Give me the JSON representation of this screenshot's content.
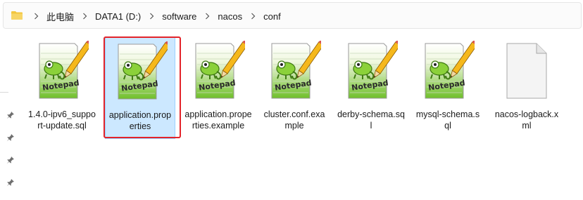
{
  "breadcrumb": {
    "items": [
      "此电脑",
      "DATA1 (D:)",
      "software",
      "nacos",
      "conf"
    ]
  },
  "files": [
    {
      "name": "1.4.0-ipv6_support-update.sql",
      "icon": "notepad-plus-plus-file-icon",
      "selected": false
    },
    {
      "name": "application.properties",
      "icon": "notepad-plus-plus-file-icon",
      "selected": true
    },
    {
      "name": "application.properties.example",
      "icon": "notepad-plus-plus-file-icon",
      "selected": false
    },
    {
      "name": "cluster.conf.example",
      "icon": "notepad-plus-plus-file-icon",
      "selected": false
    },
    {
      "name": "derby-schema.sql",
      "icon": "notepad-plus-plus-file-icon",
      "selected": false
    },
    {
      "name": "mysql-schema.sql",
      "icon": "notepad-plus-plus-file-icon",
      "selected": false
    },
    {
      "name": "nacos-logback.xml",
      "icon": "blank-file-icon",
      "selected": false
    }
  ],
  "colors": {
    "selection_bg": "#cce8ff",
    "highlight_border": "#e3232a",
    "folder": "#f3c63f"
  }
}
